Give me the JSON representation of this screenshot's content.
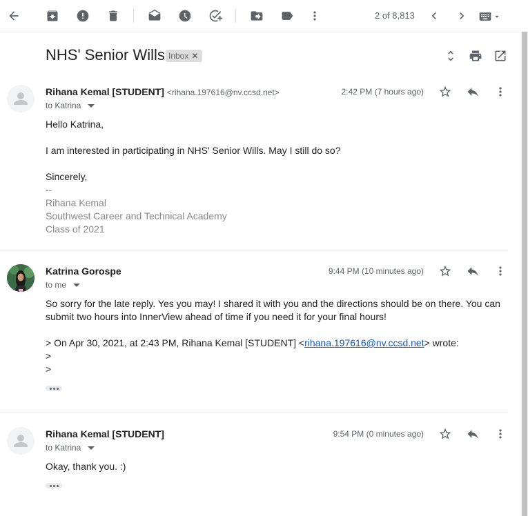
{
  "toolbar": {
    "counter": "2 of 8,813"
  },
  "thread": {
    "subject": "NHS' Senior Wills",
    "label": "Inbox"
  },
  "messages": [
    {
      "sender": "Rihana Kemal [STUDENT]",
      "sender_email": "<rihana.197616@nv.ccsd.net>",
      "recipient": "to Katrina",
      "time": "2:42 PM (7 hours ago)",
      "greeting": "Hello Katrina,",
      "line1": "I am interested in participating in NHS' Senior Wills. May I still do so?",
      "closing": "Sincerely,",
      "sig_dash": "--",
      "sig_name": "Rihana Kemal",
      "sig_school": "Southwest Career and Technical Academy",
      "sig_class": "Class of 2021"
    },
    {
      "sender": "Katrina Gorospe",
      "recipient": "to me",
      "time": "9:44 PM (10 minutes ago)",
      "line1": "So sorry for the late reply. Yes you may! I shared it with you and the directions should be on there. You can submit two hours into InnerView ahead of time if you need it for your final hours!",
      "quote_prefix": "> On Apr 30, 2021, at 2:43 PM, Rihana Kemal [STUDENT] <",
      "quote_link": "rihana.197616@nv.ccsd.net",
      "quote_suffix": "> wrote:",
      "quote_line2": ">",
      "quote_line3": ">"
    },
    {
      "sender": "Rihana Kemal [STUDENT]",
      "recipient": "to Katrina",
      "time": "9:54 PM (0 minutes ago)",
      "line1": "Okay, thank you. :)"
    }
  ]
}
